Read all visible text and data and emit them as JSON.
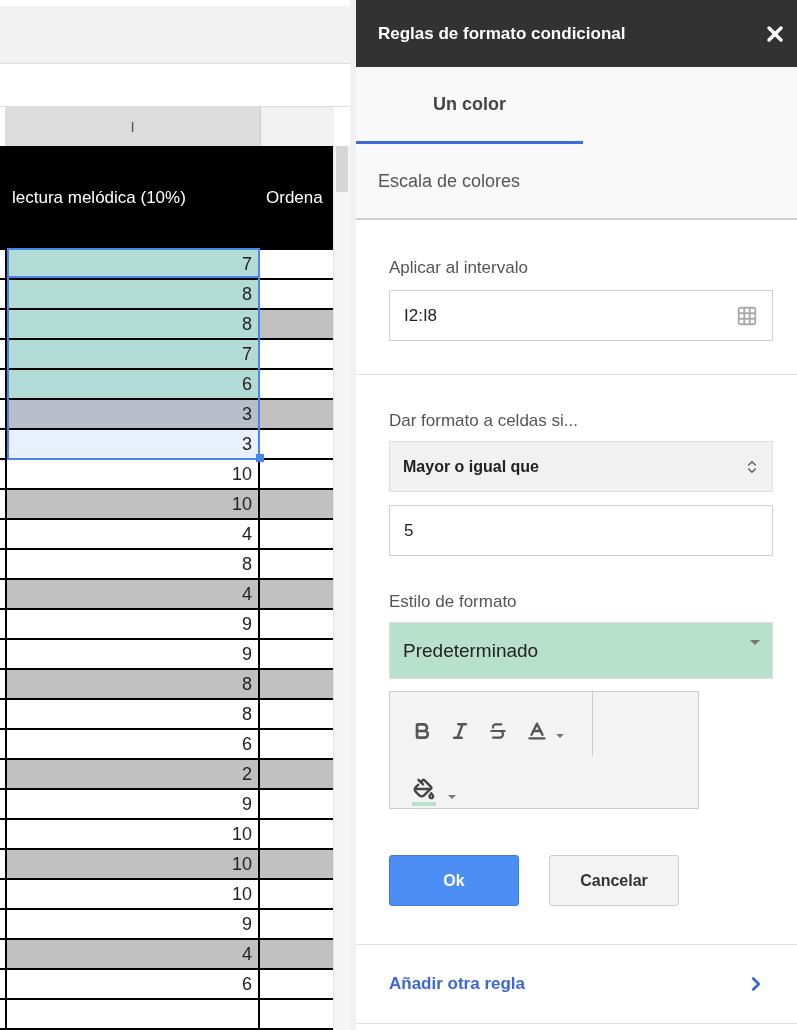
{
  "sheet": {
    "column_header": "I",
    "header_cells": [
      "lectura melódica (10%)",
      "Ordena"
    ],
    "rows": [
      {
        "value": "7",
        "striped": false,
        "highlighted": true,
        "selected": true
      },
      {
        "value": "8",
        "striped": false,
        "highlighted": true,
        "selected": true
      },
      {
        "value": "8",
        "striped": true,
        "highlighted": true,
        "selected": true
      },
      {
        "value": "7",
        "striped": false,
        "highlighted": true,
        "selected": true
      },
      {
        "value": "6",
        "striped": false,
        "highlighted": true,
        "selected": true
      },
      {
        "value": "3",
        "striped": true,
        "highlighted": false,
        "selected": true
      },
      {
        "value": "3",
        "striped": false,
        "highlighted": false,
        "selected": true
      },
      {
        "value": "10",
        "striped": false,
        "highlighted": false,
        "selected": false
      },
      {
        "value": "10",
        "striped": true,
        "highlighted": false,
        "selected": false
      },
      {
        "value": "4",
        "striped": false,
        "highlighted": false,
        "selected": false
      },
      {
        "value": "8",
        "striped": false,
        "highlighted": false,
        "selected": false
      },
      {
        "value": "4",
        "striped": true,
        "highlighted": false,
        "selected": false
      },
      {
        "value": "9",
        "striped": false,
        "highlighted": false,
        "selected": false
      },
      {
        "value": "9",
        "striped": false,
        "highlighted": false,
        "selected": false
      },
      {
        "value": "8",
        "striped": true,
        "highlighted": false,
        "selected": false
      },
      {
        "value": "8",
        "striped": false,
        "highlighted": false,
        "selected": false
      },
      {
        "value": "6",
        "striped": false,
        "highlighted": false,
        "selected": false
      },
      {
        "value": "2",
        "striped": true,
        "highlighted": false,
        "selected": false
      },
      {
        "value": "9",
        "striped": false,
        "highlighted": false,
        "selected": false
      },
      {
        "value": "10",
        "striped": false,
        "highlighted": false,
        "selected": false
      },
      {
        "value": "10",
        "striped": true,
        "highlighted": false,
        "selected": false
      },
      {
        "value": "10",
        "striped": false,
        "highlighted": false,
        "selected": false
      },
      {
        "value": "9",
        "striped": false,
        "highlighted": false,
        "selected": false
      },
      {
        "value": "4",
        "striped": true,
        "highlighted": false,
        "selected": false
      },
      {
        "value": "6",
        "striped": false,
        "highlighted": false,
        "selected": false
      }
    ]
  },
  "panel": {
    "title": "Reglas de formato condicional",
    "tabs": [
      {
        "label": "Un color",
        "selected": true
      },
      {
        "label": "Escala de colores",
        "selected": false
      }
    ],
    "range_label": "Aplicar al intervalo",
    "range_value": "I2:I8",
    "condition_label": "Dar formato a celdas si...",
    "condition_value": "Mayor o igual que",
    "threshold_value": "5",
    "style_label": "Estilo de formato",
    "style_value": "Predeterminado",
    "buttons": [
      {
        "label": "Ok",
        "kind": "primary"
      },
      {
        "label": "Cancelar",
        "kind": "secondary"
      }
    ],
    "add_rule": "Añadir otra regla"
  }
}
